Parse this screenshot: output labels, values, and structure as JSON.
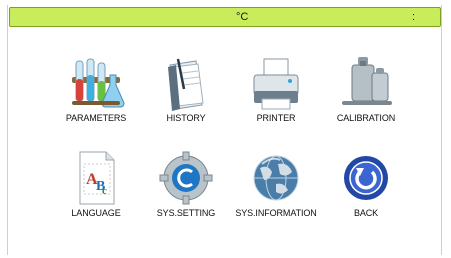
{
  "status": {
    "unit": "°C",
    "separator": ":"
  },
  "menu": {
    "parameters": "PARAMETERS",
    "history": "HISTORY",
    "printer": "PRINTER",
    "calibration": "CALIBRATION",
    "language": "LANGUAGE",
    "sys_setting": "SYS.SETTING",
    "sys_information": "SYS.INFORMATION",
    "back": "BACK"
  },
  "icons": {
    "parameters": "test-tubes-icon",
    "history": "history-book-icon",
    "printer": "printer-icon",
    "calibration": "calibration-weights-icon",
    "language": "language-document-icon",
    "sys_setting": "gear-icon",
    "sys_information": "globe-icon",
    "back": "back-arrow-icon"
  },
  "colors": {
    "status_bar": "#c8ec5a",
    "status_border": "#7aa21e"
  }
}
